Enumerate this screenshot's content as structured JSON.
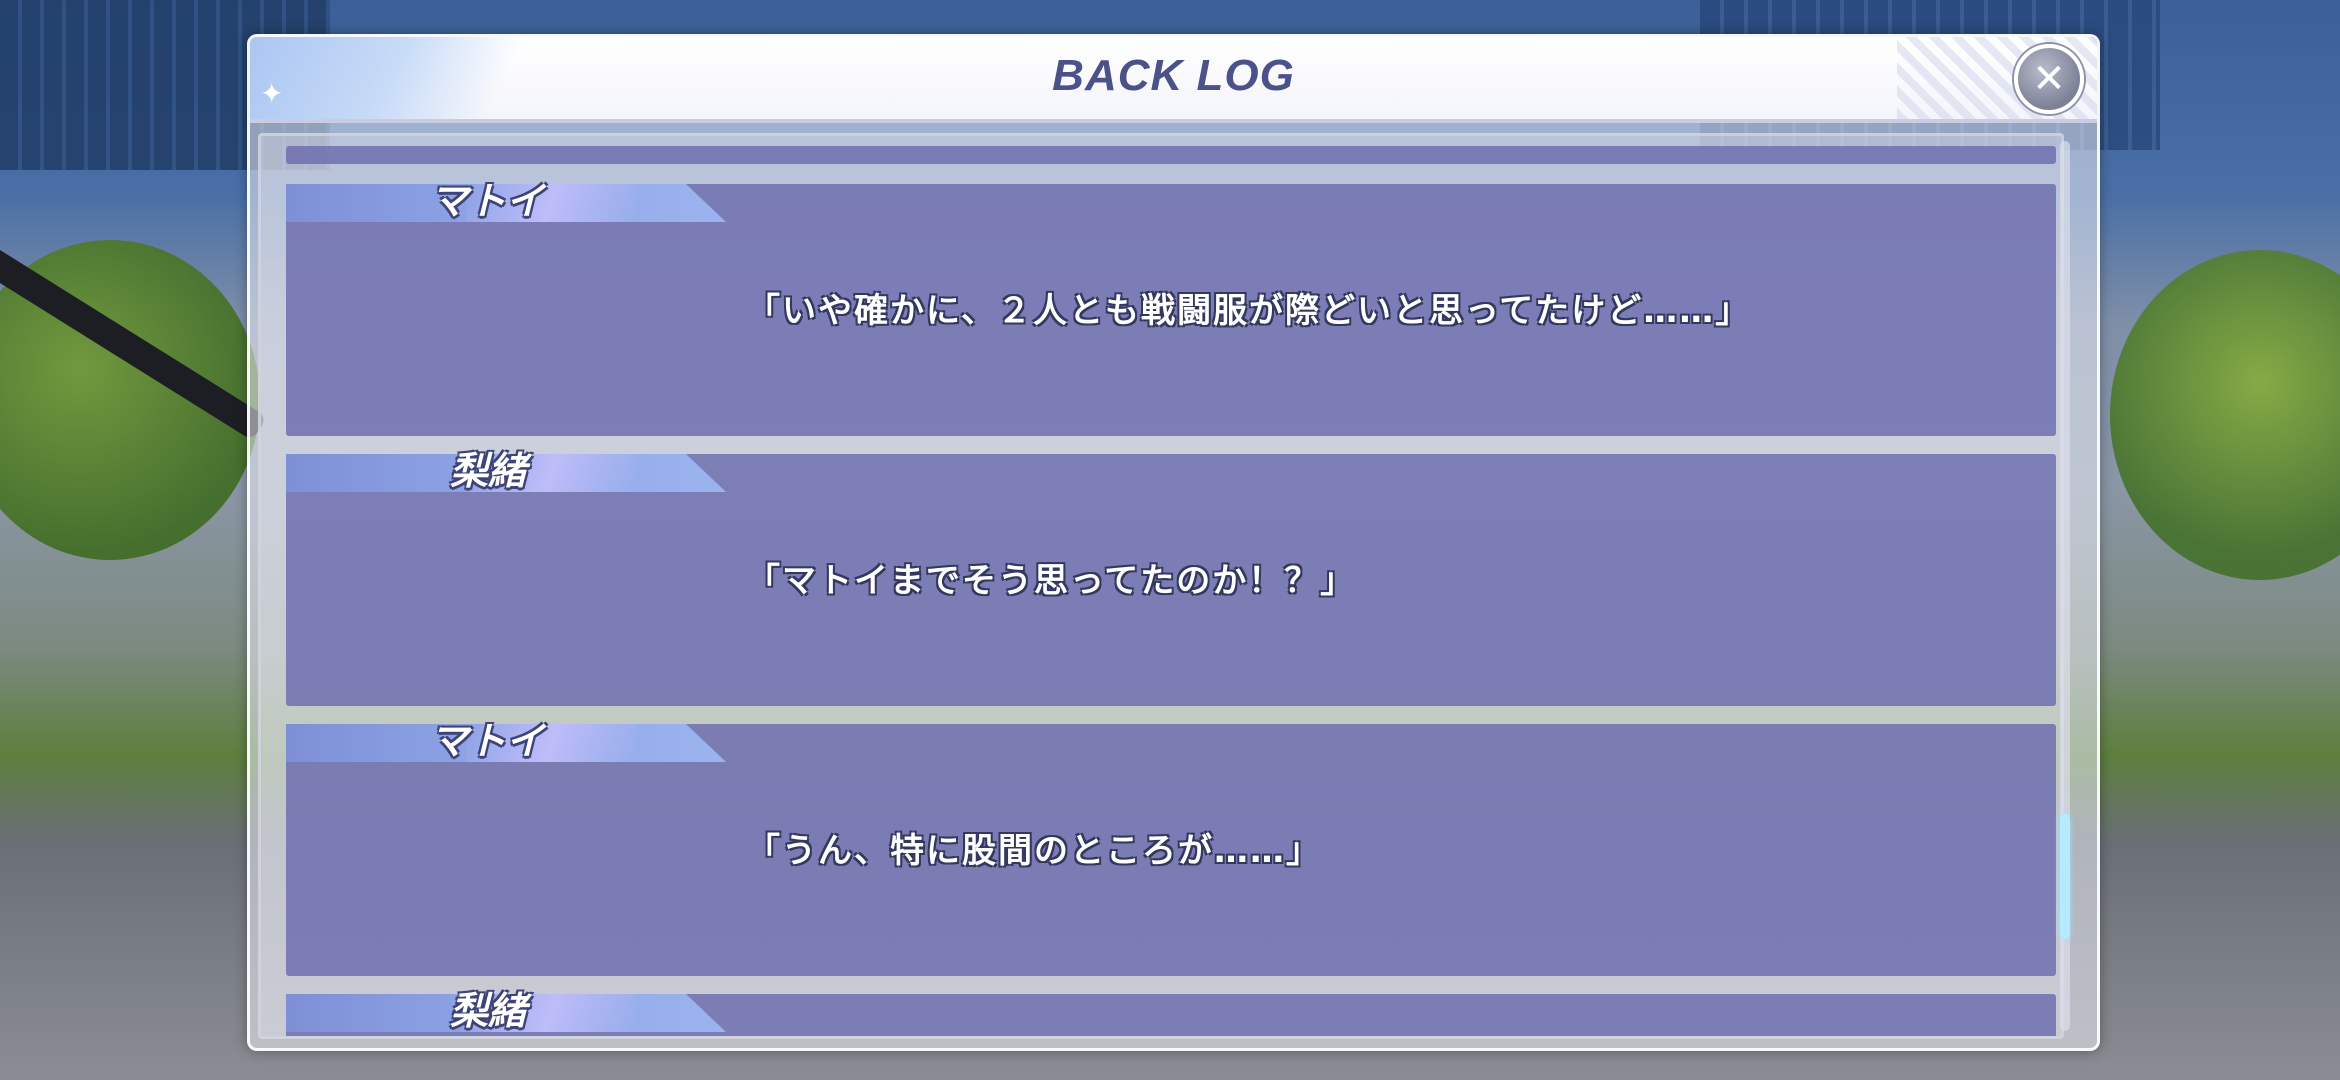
{
  "window": {
    "title": "BACK LOG",
    "close_icon": "close-icon",
    "close_glyph": "✕",
    "sparkle_glyph": "✦"
  },
  "log": {
    "entries": [
      {
        "speaker": "",
        "text": ""
      },
      {
        "speaker": "マトイ",
        "text": "「いや確かに、２人とも戦闘服が際どいと思ってたけど……」"
      },
      {
        "speaker": "梨緒",
        "text": "「マトイまでそう思ってたのか！？」"
      },
      {
        "speaker": "マトイ",
        "text": "「うん、特に股間のところが……」"
      },
      {
        "speaker": "梨緒",
        "text": ""
      }
    ]
  },
  "scrollbar": {
    "position_fraction": 0.88,
    "visible_fraction": 0.14
  },
  "colors": {
    "entry_bg": "#7070b0",
    "title": "#4b5289",
    "scroll_thumb": "#b6eaff"
  }
}
